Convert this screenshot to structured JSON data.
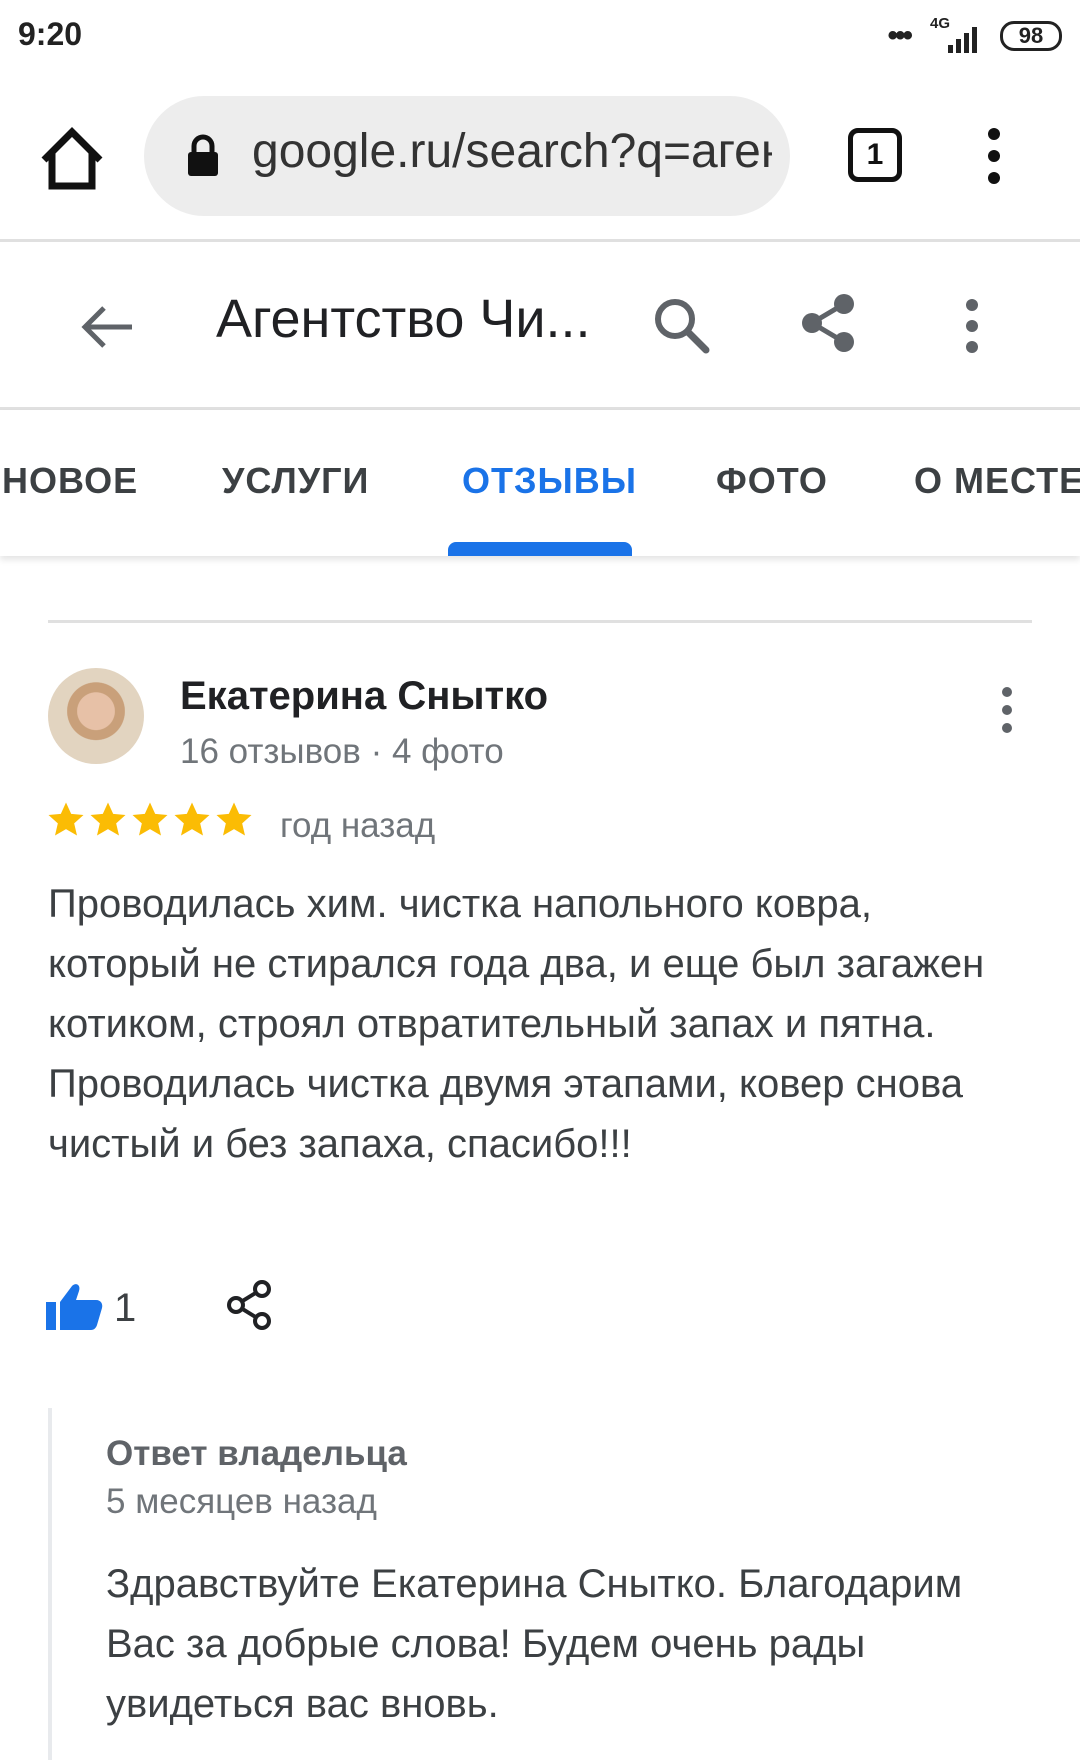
{
  "status_bar": {
    "time": "9:20",
    "network": "4G",
    "battery": "98"
  },
  "browser": {
    "url": "google.ru/search?q=агентство",
    "tab_count": "1"
  },
  "place": {
    "title": "Агентство Чи..."
  },
  "tabs": [
    {
      "label": "НОВОЕ"
    },
    {
      "label": "УСЛУГИ"
    },
    {
      "label": "ОТЗЫВЫ",
      "active": true
    },
    {
      "label": "ФОТО"
    },
    {
      "label": "О МЕСТЕ"
    }
  ],
  "review": {
    "author": "Екатерина Снытко",
    "meta": "16 отзывов · 4 фото",
    "rating": 5,
    "date": "год назад",
    "text": "Проводилась хим. чистка напольного ковра, который не стирался года два, и еще был загажен котиком, строял отвратительный запах и пятна. Проводилась чистка двумя этапами, ковер снова чистый и без запаха, спасибо!!!",
    "likes": "1"
  },
  "owner_response": {
    "title": "Ответ владельца",
    "date": "5 месяцев назад",
    "text": "Здравствуйте Екатерина Снытко. Благодарим Вас за добрые слова! Будем очень рады увидеться вас вновь."
  },
  "colors": {
    "accent": "#1a73e8",
    "star": "#fbbc04"
  }
}
